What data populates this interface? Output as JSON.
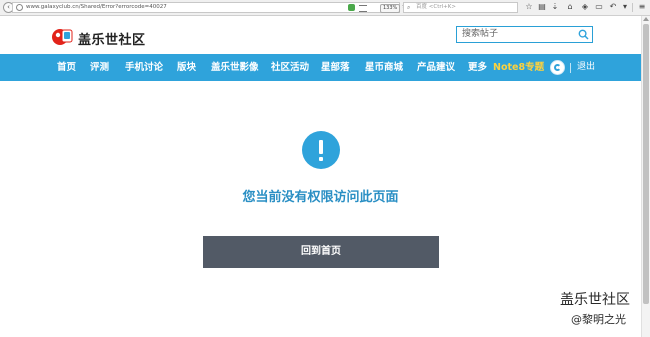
{
  "browser": {
    "url": "www.galaxyclub.cn/Shared/Error?errorcode=40027",
    "zoom": "133%",
    "search_placeholder": "百度 <Ctrl+K>"
  },
  "site": {
    "logo_text": "盖乐世社区",
    "search_placeholder": "搜索帖子"
  },
  "nav": {
    "items": [
      "首页",
      "评测",
      "手机讨论",
      "版块",
      "盖乐世影像",
      "社区活动",
      "星部落",
      "星币商城",
      "产品建议",
      "更多"
    ],
    "special": "Note8专题",
    "logout": "退出"
  },
  "main": {
    "message": "您当前没有权限访问此页面",
    "button_label": "回到首页"
  },
  "watermark": {
    "title": "盖乐世社区",
    "subtitle": "@黎明之光"
  },
  "colors": {
    "accent": "#2fa3db",
    "button": "#525a66",
    "special_nav": "#ffd23c"
  }
}
